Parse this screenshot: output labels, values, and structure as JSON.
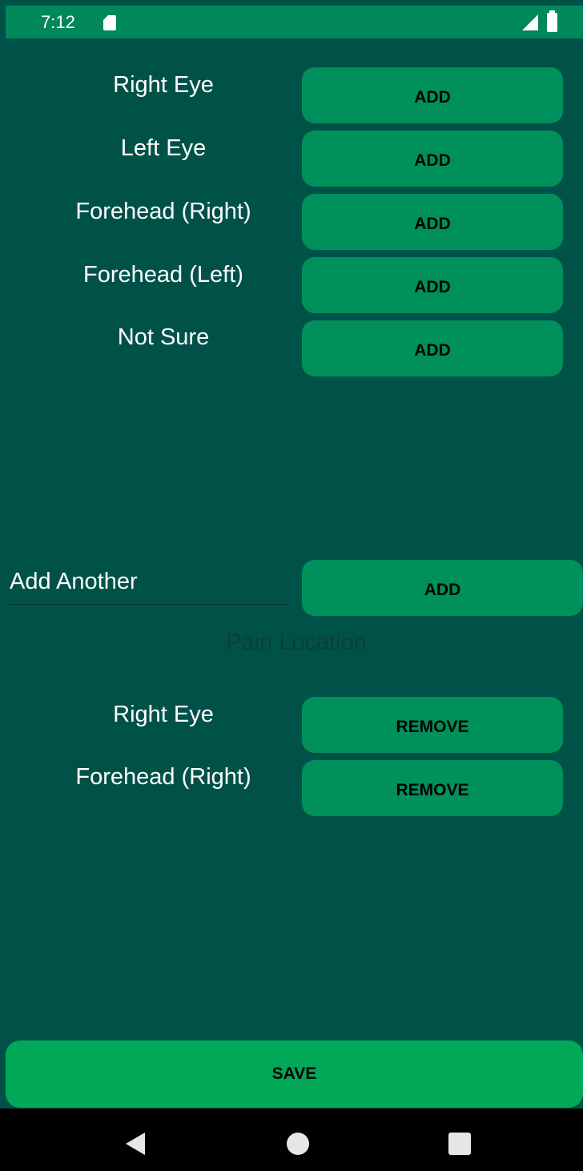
{
  "status_bar": {
    "time": "7:12",
    "icons": [
      "sd-card-icon",
      "signal-icon",
      "battery-icon"
    ]
  },
  "location_options": [
    {
      "label": "Right Eye",
      "button": "ADD"
    },
    {
      "label": "Left Eye",
      "button": "ADD"
    },
    {
      "label": "Forehead (Right)",
      "button": "ADD"
    },
    {
      "label": "Forehead (Left)",
      "button": "ADD"
    },
    {
      "label": "Not Sure",
      "button": "ADD"
    }
  ],
  "add_another": {
    "placeholder": "Add Another",
    "button": "ADD"
  },
  "section_title": "Pain Location",
  "selected_locations": [
    {
      "label": "Right Eye",
      "button": "REMOVE"
    },
    {
      "label": "Forehead (Right)",
      "button": "REMOVE"
    }
  ],
  "save_label": "SAVE",
  "nav": {
    "icons": [
      "back-icon",
      "home-icon",
      "recents-icon"
    ]
  },
  "colors": {
    "background": "#005249",
    "statusbar": "#00875A",
    "button": "#00905C",
    "save": "#00A858"
  }
}
